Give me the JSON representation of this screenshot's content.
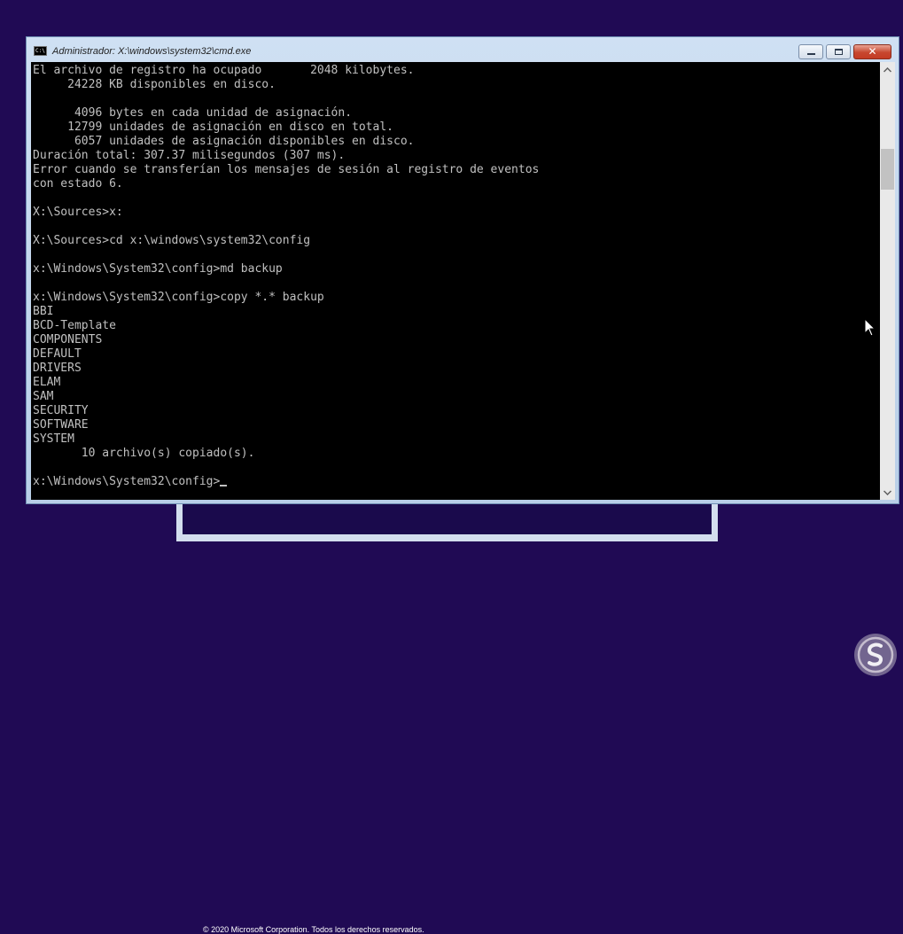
{
  "background_setup": {
    "copyright": "© 2020 Microsoft Corporation. Todos los derechos reservados."
  },
  "cmd_window": {
    "icon_text": "C:\\",
    "title": "Administrador: X:\\windows\\system32\\cmd.exe",
    "lines": [
      "El archivo de registro ha ocupado       2048 kilobytes.",
      "     24228 KB disponibles en disco.",
      "",
      "      4096 bytes en cada unidad de asignación.",
      "     12799 unidades de asignación en disco en total.",
      "      6057 unidades de asignación disponibles en disco.",
      "Duración total: 307.37 milisegundos (307 ms).",
      "Error cuando se transferían los mensajes de sesión al registro de eventos",
      "con estado 6.",
      "",
      "X:\\Sources>x:",
      "",
      "X:\\Sources>cd x:\\windows\\system32\\config",
      "",
      "x:\\Windows\\System32\\config>md backup",
      "",
      "x:\\Windows\\System32\\config>copy *.* backup",
      "BBI",
      "BCD-Template",
      "COMPONENTS",
      "DEFAULT",
      "DRIVERS",
      "ELAM",
      "SAM",
      "SECURITY",
      "SOFTWARE",
      "SYSTEM",
      "       10 archivo(s) copiado(s).",
      ""
    ],
    "prompt": "x:\\Windows\\System32\\config>"
  },
  "colors": {
    "desktop_background": "#200a54",
    "console_background": "#000000",
    "console_text": "#c0c0c0",
    "close_button": "#c7472f"
  },
  "icons": {
    "minimize": "minimize-icon",
    "maximize": "maximize-icon",
    "close": "close-icon",
    "scroll_up": "chevron-up-icon",
    "scroll_down": "chevron-down-icon",
    "pointer": "mouse-pointer-icon",
    "watermark": "watermark-logo"
  }
}
